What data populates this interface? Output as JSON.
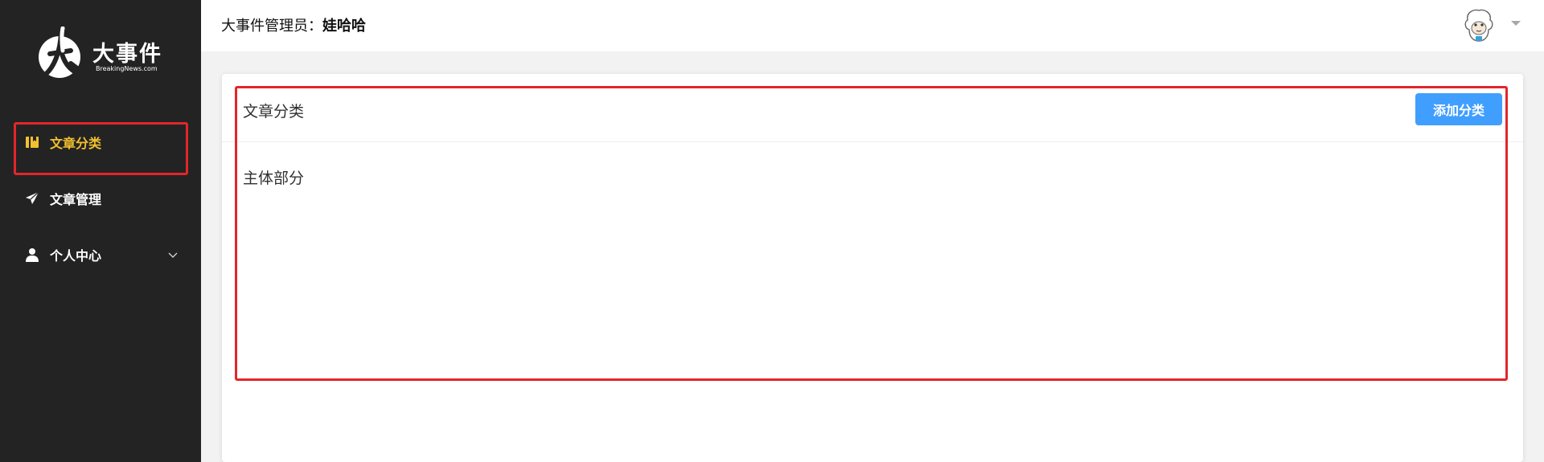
{
  "logo": {
    "title": "大事件",
    "subtitle": "BreakingNews.com"
  },
  "sidebar": {
    "items": [
      {
        "label": "文章分类",
        "icon": "book-icon",
        "active": true
      },
      {
        "label": "文章管理",
        "icon": "paper-plane-icon",
        "active": false
      },
      {
        "label": "个人中心",
        "icon": "user-icon",
        "active": false,
        "expandable": true
      }
    ]
  },
  "header": {
    "prefix": "大事件管理员：",
    "username": "娃哈哈"
  },
  "card": {
    "title": "文章分类",
    "add_button_label": "添加分类",
    "body_text": "主体部分"
  },
  "colors": {
    "sidebar_bg": "#232323",
    "active_text": "#f3c02e",
    "primary_button": "#409eff",
    "highlight_border": "#e3262a"
  }
}
